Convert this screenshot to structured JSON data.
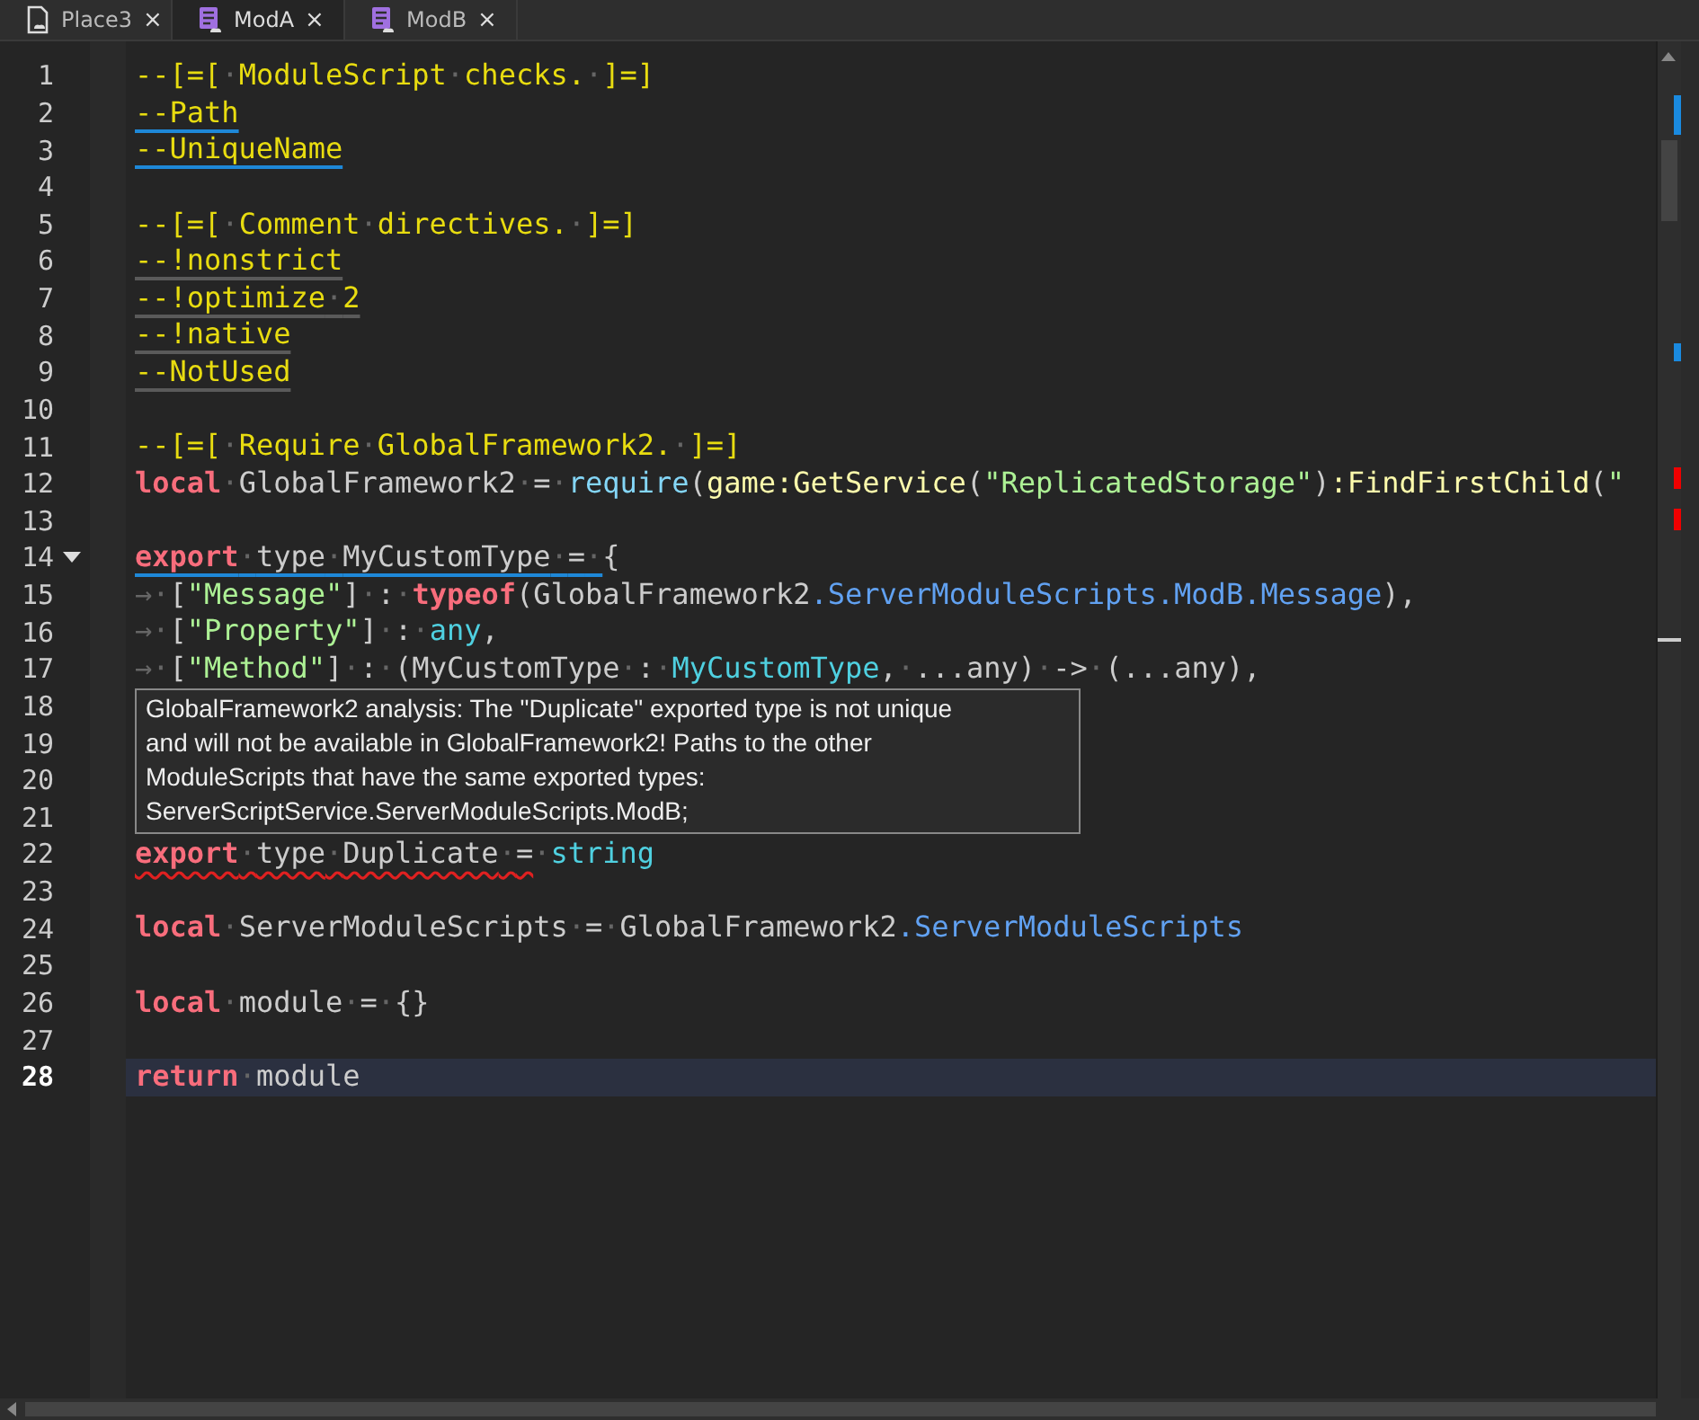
{
  "tabs": [
    {
      "label": "Place3",
      "kind": "place",
      "close": "×",
      "selected": false
    },
    {
      "label": "ModA",
      "kind": "module",
      "close": "×",
      "selected": true
    },
    {
      "label": "ModB",
      "kind": "module",
      "close": "×",
      "selected": false
    }
  ],
  "editor": {
    "lines": [
      {
        "number": "1",
        "current": false,
        "tokens": [
          {
            "kind": "comment",
            "text": "--[=[·ModuleScript·checks.·]=]"
          }
        ]
      },
      {
        "number": "2",
        "current": false,
        "tokens": [
          {
            "kind": "comment",
            "text": "--Path",
            "underline": {
              "kind": "info"
            }
          }
        ]
      },
      {
        "number": "3",
        "current": false,
        "tokens": [
          {
            "kind": "comment",
            "text": "--UniqueName",
            "underline": {
              "kind": "info"
            }
          }
        ]
      },
      {
        "number": "4",
        "current": false
      },
      {
        "number": "5",
        "current": false,
        "tokens": [
          {
            "kind": "comment",
            "text": "--[=[·Comment·directives.·]=]"
          }
        ]
      },
      {
        "number": "6",
        "current": false,
        "tokens": [
          {
            "kind": "comment",
            "text": "--!nonstrict",
            "underline": {
              "kind": "hint"
            }
          }
        ]
      },
      {
        "number": "7",
        "current": false,
        "tokens": [
          {
            "kind": "comment",
            "text": "--!optimize·2",
            "underline": {
              "kind": "hint"
            }
          }
        ]
      },
      {
        "number": "8",
        "current": false,
        "tokens": [
          {
            "kind": "comment",
            "text": "--!native",
            "underline": {
              "kind": "hint"
            }
          }
        ]
      },
      {
        "number": "9",
        "current": false,
        "tokens": [
          {
            "kind": "comment",
            "text": "--NotUsed",
            "underline": {
              "kind": "hint"
            }
          }
        ]
      },
      {
        "number": "10",
        "current": false
      },
      {
        "number": "11",
        "current": false,
        "tokens": [
          {
            "kind": "comment",
            "text": "--[=[·Require·GlobalFramework2.·]=]"
          }
        ]
      },
      {
        "number": "12",
        "current": false,
        "tokens": [
          {
            "kind": "keyword",
            "text": "local"
          },
          {
            "kind": "plain",
            "text": "·GlobalFramework2·=·"
          },
          {
            "kind": "function",
            "text": "require"
          },
          {
            "kind": "plain",
            "text": "("
          },
          {
            "kind": "global",
            "text": "game:GetService"
          },
          {
            "kind": "plain",
            "text": "("
          },
          {
            "kind": "string",
            "text": "\"ReplicatedStorage\""
          },
          {
            "kind": "plain",
            "text": ")"
          },
          {
            "kind": "global",
            "text": ":FindFirstChild"
          },
          {
            "kind": "plain",
            "text": "("
          },
          {
            "kind": "string",
            "text": "\""
          }
        ]
      },
      {
        "number": "13",
        "current": false
      },
      {
        "number": "14",
        "current": false,
        "foldable": true,
        "tokens": [
          {
            "kind": "keyword",
            "text": "export",
            "underline": {
              "kind": "info"
            }
          },
          {
            "kind": "plain",
            "text": "·type·MyCustomType·=·",
            "underline": {
              "kind": "info"
            }
          },
          {
            "kind": "plain",
            "text": "{"
          }
        ]
      },
      {
        "number": "15",
        "current": false,
        "tokens": [
          {
            "kind": "indent",
            "text": "→"
          },
          {
            "kind": "plain",
            "text": "·["
          },
          {
            "kind": "string",
            "text": "\"Message\""
          },
          {
            "kind": "plain",
            "text": "]·:·"
          },
          {
            "kind": "keyword",
            "text": "typeof"
          },
          {
            "kind": "plain",
            "text": "(GlobalFramework2"
          },
          {
            "kind": "member",
            "text": ".ServerModuleScripts.ModB.Message"
          },
          {
            "kind": "plain",
            "text": "),"
          }
        ]
      },
      {
        "number": "16",
        "current": false,
        "tokens": [
          {
            "kind": "indent",
            "text": "→"
          },
          {
            "kind": "plain",
            "text": "·["
          },
          {
            "kind": "string",
            "text": "\"Property\""
          },
          {
            "kind": "plain",
            "text": "]·:·"
          },
          {
            "kind": "type",
            "text": "any"
          },
          {
            "kind": "plain",
            "text": ","
          }
        ]
      },
      {
        "number": "17",
        "current": false,
        "tokens": [
          {
            "kind": "indent",
            "text": "→"
          },
          {
            "kind": "plain",
            "text": "·["
          },
          {
            "kind": "string",
            "text": "\"Method\""
          },
          {
            "kind": "plain",
            "text": "]·:·(MyCustomType·:·"
          },
          {
            "kind": "type",
            "text": "MyCustomType"
          },
          {
            "kind": "plain",
            "text": ",·...any)·->·(...any),"
          }
        ]
      },
      {
        "number": "18",
        "current": false
      },
      {
        "number": "19",
        "current": false
      },
      {
        "number": "20",
        "current": false
      },
      {
        "number": "21",
        "current": false
      },
      {
        "number": "22",
        "current": false,
        "tokens": [
          {
            "kind": "keyword",
            "text": "export",
            "underline": {
              "kind": "error"
            }
          },
          {
            "kind": "plain",
            "text": "·type·Duplicate·=",
            "underline": {
              "kind": "error"
            }
          },
          {
            "kind": "plain",
            "text": "·"
          },
          {
            "kind": "type",
            "text": "string"
          }
        ]
      },
      {
        "number": "23",
        "current": false
      },
      {
        "number": "24",
        "current": false,
        "tokens": [
          {
            "kind": "keyword",
            "text": "local"
          },
          {
            "kind": "plain",
            "text": "·ServerModuleScripts·=·GlobalFramework2"
          },
          {
            "kind": "member",
            "text": ".ServerModuleScripts"
          }
        ]
      },
      {
        "number": "25",
        "current": false
      },
      {
        "number": "26",
        "current": false,
        "tokens": [
          {
            "kind": "keyword",
            "text": "local"
          },
          {
            "kind": "plain",
            "text": "·module·=·{}"
          }
        ]
      },
      {
        "number": "27",
        "current": false
      },
      {
        "number": "28",
        "current": true,
        "tokens": [
          {
            "kind": "keyword",
            "text": "return"
          },
          {
            "kind": "plain",
            "text": "·module"
          }
        ]
      }
    ]
  },
  "tooltip": {
    "lines": [
      "GlobalFramework2 analysis: The \"Duplicate\" exported type is not unique",
      "and will not be available in GlobalFramework2! Paths to the other",
      "ModuleScripts that have the same exported types:",
      "ServerScriptService.ServerModuleScripts.ModB;"
    ]
  }
}
